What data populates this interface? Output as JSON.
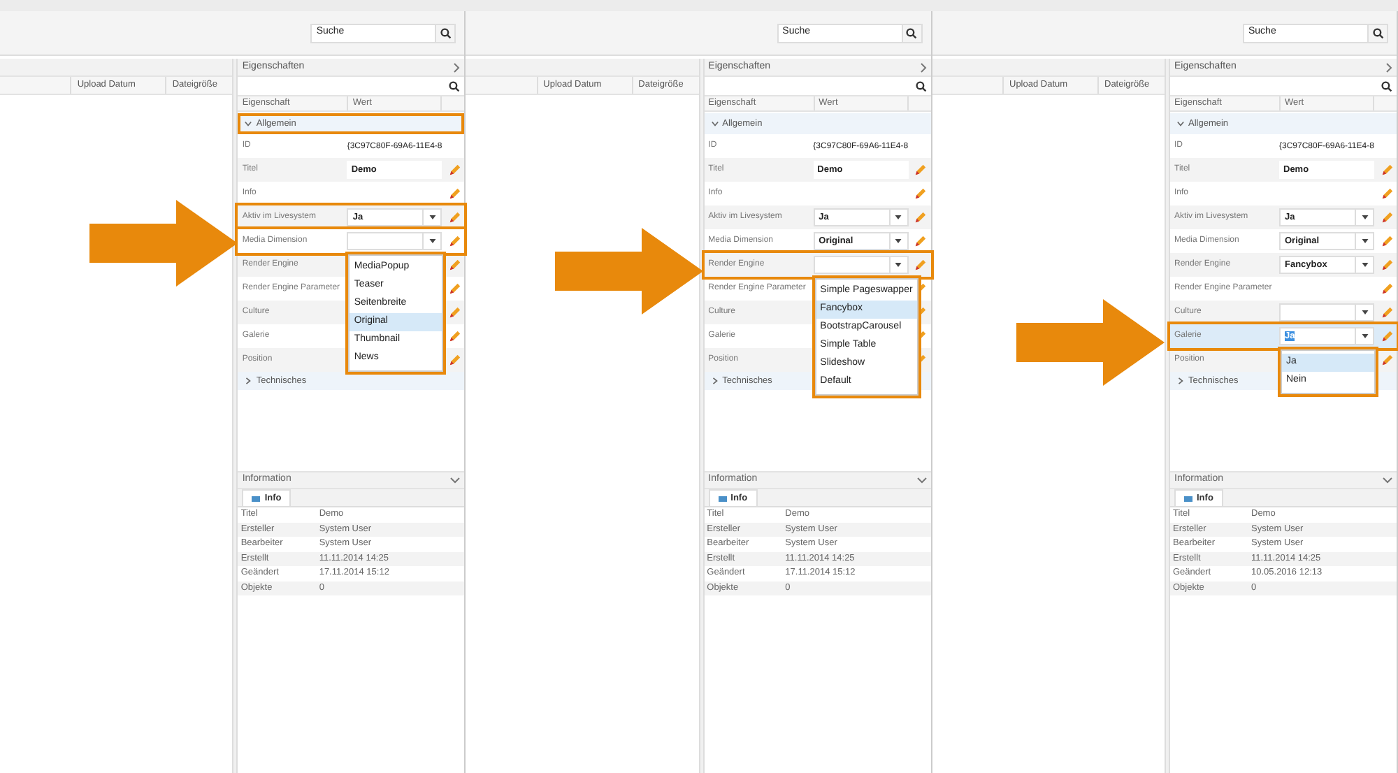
{
  "panels": [
    {
      "search": {
        "value": "Suche"
      },
      "list_columns": [
        "Upload Datum",
        "Dateigröße"
      ],
      "properties": {
        "title": "Eigenschaften",
        "columns": [
          "Eigenschaft",
          "Wert"
        ],
        "group": {
          "label": "Allgemein",
          "expanded": true,
          "highlighted": true
        },
        "rows": [
          {
            "label": "ID",
            "value": "{3C97C80F-69A6-11E4-8",
            "kind": "plain",
            "editable": false,
            "selected": false,
            "highlighted": false
          },
          {
            "label": "Titel",
            "value": "Demo",
            "kind": "text",
            "editable": true,
            "selected": false,
            "highlighted": false
          },
          {
            "label": "Info",
            "kind": "plain",
            "editable": true,
            "selected": false,
            "highlighted": false
          },
          {
            "label": "Aktiv im Livesystem",
            "value": "Ja",
            "kind": "select",
            "editable": true,
            "selected": false,
            "highlighted": true
          },
          {
            "label": "Media Dimension",
            "kind": "select",
            "editable": true,
            "selected": false,
            "highlighted": true,
            "dropdown": {
              "highlighted": true,
              "options": [
                {
                  "label": "MediaPopup",
                  "selected": false
                },
                {
                  "label": "Teaser",
                  "selected": false
                },
                {
                  "label": "Seitenbreite",
                  "selected": false
                },
                {
                  "label": "Original",
                  "selected": true
                },
                {
                  "label": "Thumbnail",
                  "selected": false
                },
                {
                  "label": "News",
                  "selected": false
                }
              ]
            }
          },
          {
            "label": "Render Engine",
            "kind": "plain",
            "editable": true,
            "selected": false,
            "highlighted": false
          },
          {
            "label": "Render Engine Parameter",
            "kind": "plain",
            "editable": true,
            "selected": false,
            "highlighted": false
          },
          {
            "label": "Culture",
            "kind": "plain",
            "editable": true,
            "selected": false,
            "highlighted": false
          },
          {
            "label": "Galerie",
            "kind": "plain",
            "editable": true,
            "selected": false,
            "highlighted": false
          },
          {
            "label": "Position",
            "kind": "plain",
            "editable": true,
            "selected": false,
            "highlighted": false
          }
        ],
        "collapsed_group": {
          "label": "Technisches",
          "expanded": false
        }
      },
      "information": {
        "title": "Information",
        "tab": "Info",
        "rows": [
          [
            "Titel",
            "Demo"
          ],
          [
            "Ersteller",
            "System User"
          ],
          [
            "Bearbeiter",
            "System User"
          ],
          [
            "Erstellt",
            "11.11.2014 14:25"
          ],
          [
            "Geändert",
            "17.11.2014 15:12"
          ],
          [
            "Objekte",
            "0"
          ]
        ]
      }
    },
    {
      "search": {
        "value": "Suche"
      },
      "list_columns": [
        "Upload Datum",
        "Dateigröße"
      ],
      "properties": {
        "title": "Eigenschaften",
        "columns": [
          "Eigenschaft",
          "Wert"
        ],
        "group": {
          "label": "Allgemein",
          "expanded": true,
          "highlighted": false
        },
        "rows": [
          {
            "label": "ID",
            "value": "{3C97C80F-69A6-11E4-8",
            "kind": "plain",
            "editable": false,
            "selected": false,
            "highlighted": false
          },
          {
            "label": "Titel",
            "value": "Demo",
            "kind": "text",
            "editable": true,
            "selected": false,
            "highlighted": false
          },
          {
            "label": "Info",
            "kind": "plain",
            "editable": true,
            "selected": false,
            "highlighted": false
          },
          {
            "label": "Aktiv im Livesystem",
            "value": "Ja",
            "kind": "select",
            "editable": true,
            "selected": false,
            "highlighted": false
          },
          {
            "label": "Media Dimension",
            "value": "Original",
            "kind": "select",
            "editable": true,
            "selected": false,
            "highlighted": false
          },
          {
            "label": "Render Engine",
            "kind": "select",
            "editable": true,
            "selected": false,
            "highlighted": true,
            "dropdown": {
              "highlighted": true,
              "options": [
                {
                  "label": "Simple Pageswapper",
                  "selected": false
                },
                {
                  "label": "Fancybox",
                  "selected": true
                },
                {
                  "label": "BootstrapCarousel",
                  "selected": false
                },
                {
                  "label": "Simple Table",
                  "selected": false
                },
                {
                  "label": "Slideshow",
                  "selected": false
                },
                {
                  "label": "Default",
                  "selected": false
                }
              ]
            }
          },
          {
            "label": "Render Engine Parameter",
            "kind": "plain",
            "editable": true,
            "selected": false,
            "highlighted": false
          },
          {
            "label": "Culture",
            "kind": "plain",
            "editable": true,
            "selected": false,
            "highlighted": false
          },
          {
            "label": "Galerie",
            "kind": "plain",
            "editable": true,
            "selected": false,
            "highlighted": false
          },
          {
            "label": "Position",
            "kind": "plain",
            "editable": true,
            "selected": false,
            "highlighted": false
          }
        ],
        "collapsed_group": {
          "label": "Technisches",
          "expanded": false
        }
      },
      "information": {
        "title": "Information",
        "tab": "Info",
        "rows": [
          [
            "Titel",
            "Demo"
          ],
          [
            "Ersteller",
            "System User"
          ],
          [
            "Bearbeiter",
            "System User"
          ],
          [
            "Erstellt",
            "11.11.2014 14:25"
          ],
          [
            "Geändert",
            "17.11.2014 15:12"
          ],
          [
            "Objekte",
            "0"
          ]
        ]
      }
    },
    {
      "search": {
        "value": "Suche"
      },
      "list_columns": [
        "Upload Datum",
        "Dateigröße"
      ],
      "properties": {
        "title": "Eigenschaften",
        "columns": [
          "Eigenschaft",
          "Wert"
        ],
        "group": {
          "label": "Allgemein",
          "expanded": true,
          "highlighted": false
        },
        "rows": [
          {
            "label": "ID",
            "value": "{3C97C80F-69A6-11E4-8",
            "kind": "plain",
            "editable": false,
            "selected": false,
            "highlighted": false
          },
          {
            "label": "Titel",
            "value": "Demo",
            "kind": "text",
            "editable": true,
            "selected": false,
            "highlighted": false
          },
          {
            "label": "Info",
            "kind": "plain",
            "editable": true,
            "selected": false,
            "highlighted": false
          },
          {
            "label": "Aktiv im Livesystem",
            "value": "Ja",
            "kind": "select",
            "editable": true,
            "selected": false,
            "highlighted": false
          },
          {
            "label": "Media Dimension",
            "value": "Original",
            "kind": "select",
            "editable": true,
            "selected": false,
            "highlighted": false
          },
          {
            "label": "Render Engine",
            "value": "Fancybox",
            "kind": "select",
            "editable": true,
            "selected": false,
            "highlighted": false
          },
          {
            "label": "Render Engine Parameter",
            "kind": "plain",
            "editable": true,
            "selected": false,
            "highlighted": false
          },
          {
            "label": "Culture",
            "kind": "select",
            "editable": true,
            "selected": false,
            "highlighted": false
          },
          {
            "label": "Galerie",
            "value": "Ja",
            "kind": "select",
            "editable": true,
            "selected": true,
            "highlighted": true,
            "dropdown": {
              "highlighted": true,
              "options": [
                {
                  "label": "Ja",
                  "selected": true
                },
                {
                  "label": "Nein",
                  "selected": false
                }
              ]
            }
          },
          {
            "label": "Position",
            "kind": "plain",
            "editable": true,
            "selected": false,
            "highlighted": false
          }
        ],
        "collapsed_group": {
          "label": "Technisches",
          "expanded": false
        }
      },
      "information": {
        "title": "Information",
        "tab": "Info",
        "rows": [
          [
            "Titel",
            "Demo"
          ],
          [
            "Ersteller",
            "System User"
          ],
          [
            "Bearbeiter",
            "System User"
          ],
          [
            "Erstellt",
            "11.11.2014 14:25"
          ],
          [
            "Geändert",
            "10.05.2016 12:13"
          ],
          [
            "Objekte",
            "0"
          ]
        ]
      }
    }
  ]
}
